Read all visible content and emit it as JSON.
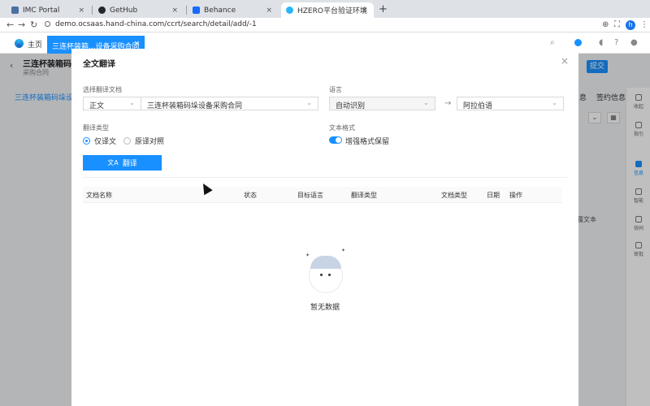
{
  "browser": {
    "tabs": [
      {
        "title": "IMC Portal",
        "color": "#4a6fa5"
      },
      {
        "title": "GetHub",
        "color": "#24292e"
      },
      {
        "title": "Behance",
        "color": "#1769ff"
      },
      {
        "title": "HZERO平台验证环境",
        "color": "#29b6f6"
      }
    ],
    "tab_close": "×",
    "new_tab": "+",
    "url": "demo.ocsaas.hand-china.com/ccrt/search/detail/add/-1",
    "profile_initial": "h"
  },
  "app": {
    "home": "主页",
    "active_tab": "三连杯装箱...设备采购合同",
    "tab_close": "×",
    "doc_title": "三连杯装箱码垛",
    "doc_subtitle": "采购合同",
    "section_tab": "三连杯装箱码垛设备",
    "submit": "提交",
    "right_tabs": [
      "息",
      "签约信息"
    ],
    "bg_text": "履文本",
    "sidebar": [
      "收起",
      "指引",
      "信息",
      "智能",
      "协同",
      "审批"
    ]
  },
  "modal": {
    "title": "全文翻译",
    "close": "×",
    "select_doc_label": "选择翻译文档",
    "doc_type": "正文",
    "doc_name": "三连杯装箱码垛设备采购合同",
    "language_label": "语言",
    "source_lang": "自动识别",
    "target_lang": "阿拉伯语",
    "arrow": "→",
    "translate_type_label": "翻译类型",
    "type_options": [
      "仅译文",
      "原译对照"
    ],
    "text_format_label": "文本格式",
    "format_option": "增强格式保留",
    "translate_button": "翻译",
    "columns": [
      "文档名称",
      "状态",
      "目标语言",
      "翻译类型",
      "文档类型",
      "日期",
      "操作"
    ],
    "empty_text": "暂无数据"
  }
}
